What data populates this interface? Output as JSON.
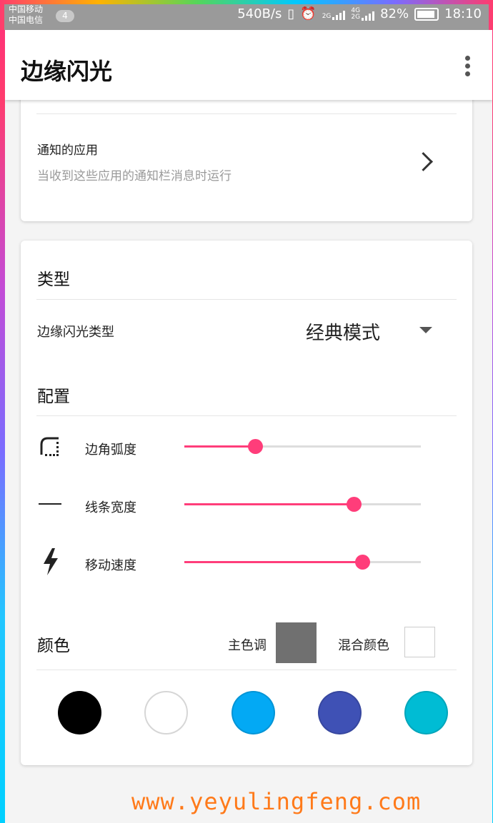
{
  "status_bar": {
    "carrier1": "中国移动",
    "carrier2": "中国电信",
    "notif_count": "4",
    "net_speed": "540B/s",
    "signal_label": "2G",
    "signal2_label_top": "4G",
    "signal2_label_bottom": "2G",
    "battery": "82%",
    "time": "18:10"
  },
  "app_bar": {
    "title": "边缘闪光",
    "menu_icon": "more-vert-icon"
  },
  "notify_card": {
    "item_title": "通知的应用",
    "item_subtitle": "当收到这些应用的通知栏消息时运行"
  },
  "type_section": {
    "header": "类型",
    "edge_type_label": "边缘闪光类型",
    "edge_type_value": "经典模式"
  },
  "config_section": {
    "header": "配置",
    "sliders": [
      {
        "label": "边角弧度",
        "icon": "rounded-corner-icon",
        "value": 0.3
      },
      {
        "label": "线条宽度",
        "icon": "line-width-icon",
        "value": 0.715
      },
      {
        "label": "移动速度",
        "icon": "flash-icon",
        "value": 0.752
      }
    ]
  },
  "color_section": {
    "header": "颜色",
    "primary_label": "主色调",
    "primary_color": "#707070",
    "mix_label": "混合颜色",
    "mix_color": "#ffffff",
    "palette": [
      "#000000",
      "#ffffff",
      "#03a9f4",
      "#3f51b5",
      "#00bcd4"
    ]
  },
  "accent_color": "#ff3d7a",
  "watermark": "www.yeyulingfeng.com"
}
